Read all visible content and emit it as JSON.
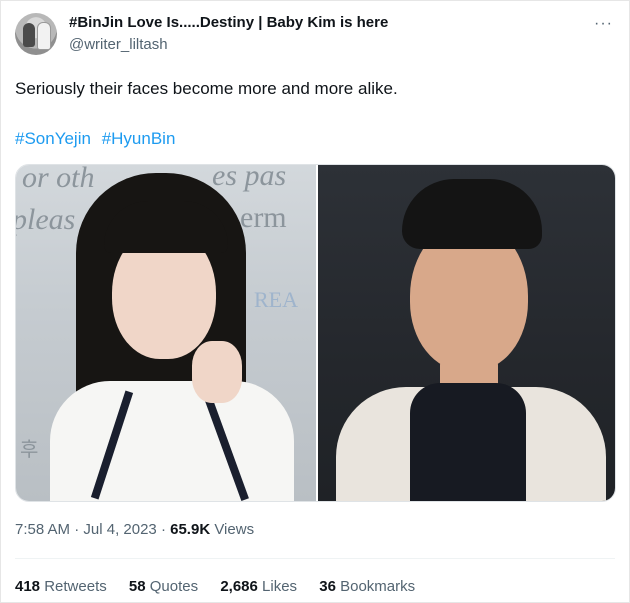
{
  "user": {
    "display_name": "#BinJin Love Is.....Destiny | Baby Kim is here",
    "handle": "@writer_liltash"
  },
  "more_icon": "more-horizontal-icon",
  "tweet": {
    "text": "Seriously their faces become more and more alike.",
    "hashtags": [
      "#SonYejin",
      "#HyunBin"
    ]
  },
  "media": {
    "left_photo": {
      "background_text": [
        "or oth",
        "pleas",
        "es pas",
        "erm",
        "REA",
        "후"
      ]
    },
    "right_photo": {}
  },
  "timestamp": {
    "time": "7:58 AM",
    "separator1": " · ",
    "date": "Jul 4, 2023",
    "separator2": " · ",
    "views_count": "65.9K",
    "views_label": " Views"
  },
  "stats": [
    {
      "count": "418",
      "label": "Retweets"
    },
    {
      "count": "58",
      "label": "Quotes"
    },
    {
      "count": "2,686",
      "label": "Likes"
    },
    {
      "count": "36",
      "label": "Bookmarks"
    }
  ],
  "colors": {
    "link": "#1d9bf0",
    "secondary_text": "#536471",
    "primary_text": "#0f1419"
  }
}
